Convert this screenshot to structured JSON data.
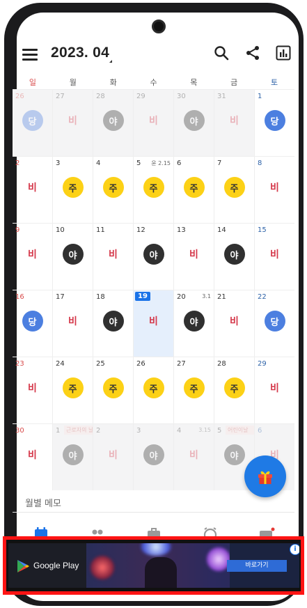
{
  "header": {
    "title": "2023. 04"
  },
  "weekdays": [
    "일",
    "월",
    "화",
    "수",
    "목",
    "금",
    "토"
  ],
  "weeks": [
    [
      {
        "n": "26",
        "badge": "당",
        "faded": true
      },
      {
        "n": "27",
        "badge": "비",
        "faded": true
      },
      {
        "n": "28",
        "badge": "야",
        "faded": true
      },
      {
        "n": "29",
        "badge": "비",
        "faded": true
      },
      {
        "n": "30",
        "badge": "야",
        "faded": true
      },
      {
        "n": "31",
        "badge": "비",
        "faded": true
      },
      {
        "n": "1",
        "badge": "당"
      }
    ],
    [
      {
        "n": "2",
        "badge": "비"
      },
      {
        "n": "3",
        "badge": "주"
      },
      {
        "n": "4",
        "badge": "주"
      },
      {
        "n": "5",
        "badge": "주",
        "note": "윤 2.15"
      },
      {
        "n": "6",
        "badge": "주"
      },
      {
        "n": "7",
        "badge": "주"
      },
      {
        "n": "8",
        "badge": "비"
      }
    ],
    [
      {
        "n": "9",
        "badge": "비"
      },
      {
        "n": "10",
        "badge": "야"
      },
      {
        "n": "11",
        "badge": "비"
      },
      {
        "n": "12",
        "badge": "야"
      },
      {
        "n": "13",
        "badge": "비"
      },
      {
        "n": "14",
        "badge": "야"
      },
      {
        "n": "15",
        "badge": "비"
      }
    ],
    [
      {
        "n": "16",
        "badge": "당"
      },
      {
        "n": "17",
        "badge": "비"
      },
      {
        "n": "18",
        "badge": "야"
      },
      {
        "n": "19",
        "badge": "비",
        "today": true
      },
      {
        "n": "20",
        "badge": "야",
        "note": "3.1"
      },
      {
        "n": "21",
        "badge": "비"
      },
      {
        "n": "22",
        "badge": "당"
      }
    ],
    [
      {
        "n": "23",
        "badge": "비"
      },
      {
        "n": "24",
        "badge": "주"
      },
      {
        "n": "25",
        "badge": "주"
      },
      {
        "n": "26",
        "badge": "주"
      },
      {
        "n": "27",
        "badge": "주"
      },
      {
        "n": "28",
        "badge": "주"
      },
      {
        "n": "29",
        "badge": "비"
      }
    ],
    [
      {
        "n": "30",
        "badge": "비"
      },
      {
        "n": "1",
        "badge": "야",
        "faded": true,
        "pinknote": "근로자의 날"
      },
      {
        "n": "2",
        "badge": "비",
        "faded": true
      },
      {
        "n": "3",
        "badge": "야",
        "faded": true
      },
      {
        "n": "4",
        "badge": "비",
        "faded": true,
        "note": "3.15"
      },
      {
        "n": "5",
        "badge": "야",
        "faded": true,
        "pinknote": "어린이날"
      },
      {
        "n": "6",
        "badge": "비",
        "faded": true
      }
    ]
  ],
  "memo": {
    "label": "월별 메모"
  },
  "ad": {
    "store": "Google Play",
    "cta": "바로가기",
    "info": "i"
  }
}
